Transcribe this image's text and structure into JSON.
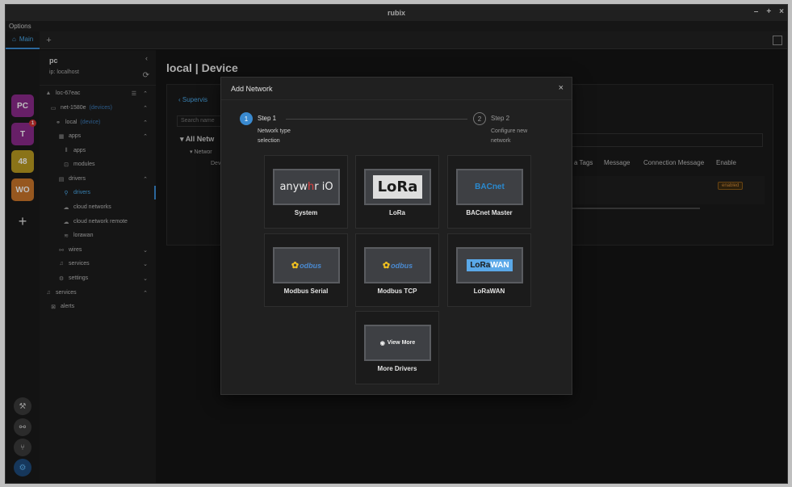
{
  "window": {
    "title": "rubix",
    "controls": [
      "–",
      "+",
      "×"
    ]
  },
  "menu": {
    "options": "Options"
  },
  "tabs": [
    {
      "label": "Main"
    }
  ],
  "rail": {
    "items": [
      {
        "label": "PC",
        "color": "#8a2a8a"
      },
      {
        "label": "T",
        "color": "#8a2a8a",
        "badge": "1"
      },
      {
        "label": "48",
        "color": "#b89a20"
      },
      {
        "label": "WO",
        "color": "#c8742a"
      }
    ],
    "add": "+"
  },
  "sidebar": {
    "title": "pc",
    "ip": "ip: localhost",
    "tree": [
      {
        "label": "loc-67eac",
        "suffix": ""
      },
      {
        "label": "net-1580e",
        "suffix": "(devices)"
      },
      {
        "label": "local",
        "suffix": "(device)"
      },
      {
        "label": "apps",
        "suffix": ""
      },
      {
        "label": "apps",
        "suffix": ""
      },
      {
        "label": "modules",
        "suffix": ""
      },
      {
        "label": "drivers",
        "suffix": ""
      },
      {
        "label": "drivers",
        "suffix": ""
      },
      {
        "label": "cloud networks",
        "suffix": ""
      },
      {
        "label": "cloud network remote",
        "suffix": ""
      },
      {
        "label": "lorawan",
        "suffix": ""
      },
      {
        "label": "wires",
        "suffix": ""
      },
      {
        "label": "services",
        "suffix": ""
      },
      {
        "label": "settings",
        "suffix": ""
      },
      {
        "label": "services",
        "suffix": ""
      },
      {
        "label": "alerts",
        "suffix": ""
      }
    ]
  },
  "page": {
    "title": "local | Device",
    "supervisor": "Supervis",
    "search_placeholder": "Search name",
    "all_networks": "All Netw",
    "network": "Networ",
    "dev": "Dev",
    "columns": [
      "a Tags",
      "Message",
      "Connection Message",
      "Enable"
    ],
    "enabled": "enabled"
  },
  "modal": {
    "title": "Add Network",
    "close": "×",
    "steps": [
      {
        "num": "1",
        "title": "Step 1",
        "desc": "Network type selection"
      },
      {
        "num": "2",
        "title": "Step 2",
        "desc": "Configure new network"
      }
    ],
    "drivers": [
      {
        "label": "System",
        "logo": "anywhere-io-logo"
      },
      {
        "label": "LoRa",
        "logo": "lora-logo"
      },
      {
        "label": "BACnet Master",
        "logo": "bacnet-logo"
      },
      {
        "label": "Modbus Serial",
        "logo": "modbus-logo"
      },
      {
        "label": "Modbus TCP",
        "logo": "modbus-logo"
      },
      {
        "label": "LoRaWAN",
        "logo": "lorawan-logo"
      },
      {
        "label": "More Drivers",
        "logo": "view-more-logo"
      }
    ],
    "logo_text": {
      "anyw_a": "anyw",
      "anyw_b": "h",
      "anyw_c": "r",
      "anyw_d": " iO",
      "lora": "LoRa",
      "bacnet": "BACnet",
      "modbus": "odbus",
      "lorawan_a": "LoRa",
      "lorawan_b": "WAN",
      "view_more": "View More"
    }
  }
}
